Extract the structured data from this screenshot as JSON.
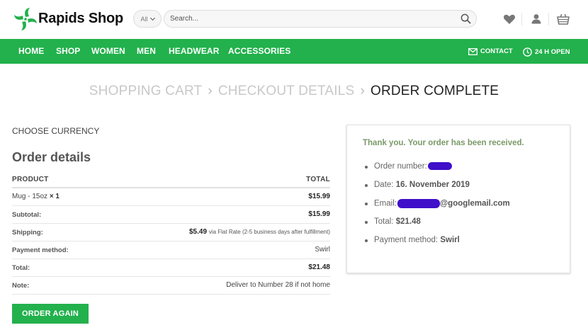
{
  "brand": {
    "name": "Rapids Shop",
    "accent": "#22b14c"
  },
  "search": {
    "category": "All",
    "placeholder": "Search..."
  },
  "header_icons": [
    "heart-icon",
    "user-icon",
    "cart-icon"
  ],
  "nav": {
    "items": [
      "HOME",
      "SHOP",
      "WOMEN",
      "MEN",
      "HEADWEAR",
      "ACCESSORIES"
    ],
    "contact": "CONTACT",
    "hours": "24 H OPEN"
  },
  "breadcrumb": {
    "step1": "SHOPPING CART",
    "step2": "CHECKOUT DETAILS",
    "step3": "ORDER COMPLETE",
    "separator": "›"
  },
  "left": {
    "choose_currency": "CHOOSE CURRENCY",
    "title": "Order details",
    "col_product": "PRODUCT",
    "col_total": "TOTAL",
    "items": [
      {
        "name": "Mug - 15oz",
        "qty": "× 1",
        "total": "$15.99"
      }
    ],
    "subtotal_label": "Subtotal:",
    "subtotal_value": "$15.99",
    "shipping_label": "Shipping:",
    "shipping_amount": "$5.49",
    "shipping_via": "via Flat Rate (2-5 business days after fulfillment)",
    "payment_label": "Payment method:",
    "payment_value": "Swirl",
    "total_label": "Total:",
    "total_value": "$21.48",
    "note_label": "Note:",
    "note_value": "Deliver to Number 28 if not home",
    "order_again": "ORDER AGAIN"
  },
  "right": {
    "thanks": "Thank you. Your order has been received.",
    "order_number_label": "Order number:",
    "date_label": "Date:",
    "date_value": "16. November 2019",
    "email_label": "Email:",
    "email_domain": "@googlemail.com",
    "total_label": "Total:",
    "total_value": "$21.48",
    "payment_label": "Payment method:",
    "payment_value": "Swirl",
    "redaction_color": "#3f0fc9"
  }
}
